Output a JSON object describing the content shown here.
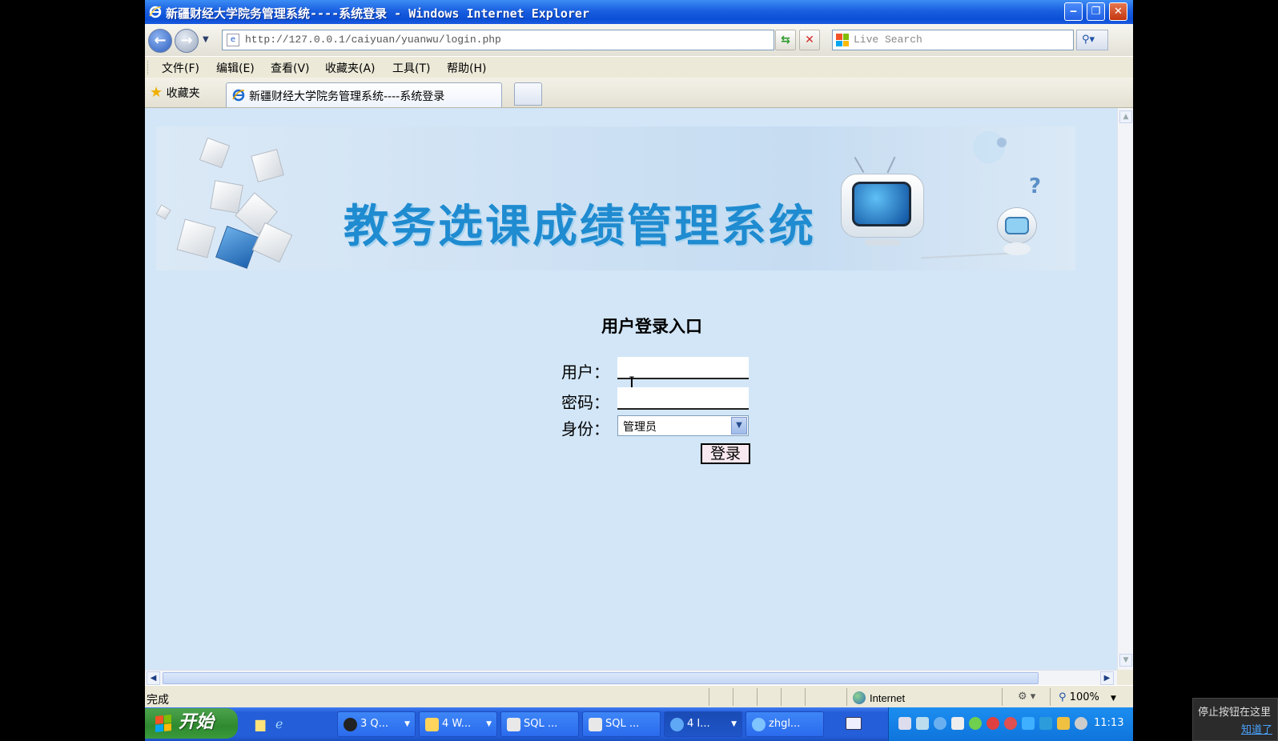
{
  "window": {
    "title": "新疆财经大学院务管理系统----系统登录 - Windows Internet Explorer",
    "minimize_glyph": "‒",
    "restore_glyph": "❐",
    "close_glyph": "✕"
  },
  "toolbar": {
    "back_glyph": "←",
    "forward_glyph": "→",
    "address": "http://127.0.0.1/caiyuan/yuanwu/login.php",
    "refresh_glyph": "⇆",
    "stop_glyph": "✕",
    "search_placeholder": "Live Search",
    "search_glyph": "⚲▾"
  },
  "menu": {
    "items": [
      "文件(F)",
      "编辑(E)",
      "查看(V)",
      "收藏夹(A)",
      "工具(T)",
      "帮助(H)"
    ]
  },
  "tabs": {
    "favorites_label": "收藏夹",
    "active_tab_label": "新疆财经大学院务管理系统----系统登录"
  },
  "page": {
    "banner_title": "教务选课成绩管理系统",
    "login_heading": "用户登录入口",
    "user_label": "用户：",
    "password_label": "密码：",
    "role_label": "身份：",
    "user_value": "",
    "password_value": "",
    "role_value": "管理员",
    "login_button": "登录"
  },
  "status": {
    "text": "完成",
    "zone": "Internet",
    "zoom": "100%"
  },
  "taskbar": {
    "start_label": "开始",
    "buttons": [
      {
        "label": "3 Q..."
      },
      {
        "label": "4 W..."
      },
      {
        "label": "SQL ..."
      },
      {
        "label": "SQL ..."
      },
      {
        "label": "4 I..."
      },
      {
        "label": "zhgl..."
      }
    ],
    "clock": "11:13"
  },
  "tooltip": {
    "text": "停止按钮在这里",
    "link": "知道了"
  },
  "colors": {
    "content_bg": "#d2e6f7",
    "banner_title": "#1f8bd0",
    "titlebar": "#0b4fd6",
    "taskbar": "#245ed9"
  }
}
